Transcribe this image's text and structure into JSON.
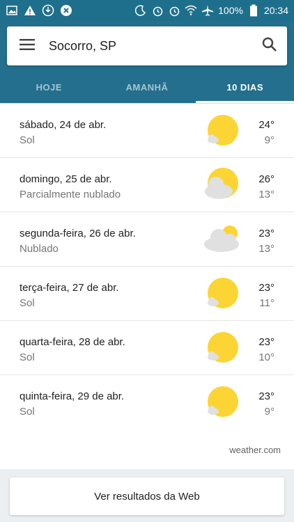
{
  "status_bar": {
    "battery": "100%",
    "time": "20:34",
    "left_icons": [
      "image-icon",
      "warning-icon",
      "download-icon",
      "blocked-icon"
    ],
    "right_icons": [
      "do-not-disturb-icon",
      "alarm-icon",
      "alarm-icon",
      "wifi-icon",
      "airplane-icon",
      "battery-icon"
    ]
  },
  "search": {
    "title": "Socorro, SP",
    "menu_icon": "menu-icon",
    "search_icon": "search-icon"
  },
  "tabs": [
    {
      "label": "HOJE",
      "active": false
    },
    {
      "label": "AMANHÃ",
      "active": false
    },
    {
      "label": "10 DIAS",
      "active": true
    }
  ],
  "days": [
    {
      "date": "sábado, 24 de abr.",
      "condition": "Sol",
      "high": "24°",
      "low": "9°",
      "icon": "sun-icon"
    },
    {
      "date": "domingo, 25 de abr.",
      "condition": "Parcialmente nublado",
      "high": "26°",
      "low": "13°",
      "icon": "partly-cloudy-icon"
    },
    {
      "date": "segunda-feira, 26 de abr.",
      "condition": "Nublado",
      "high": "23°",
      "low": "13°",
      "icon": "cloudy-icon"
    },
    {
      "date": "terça-feira, 27 de abr.",
      "condition": "Sol",
      "high": "23°",
      "low": "11°",
      "icon": "sun-icon"
    },
    {
      "date": "quarta-feira, 28 de abr.",
      "condition": "Sol",
      "high": "23°",
      "low": "10°",
      "icon": "sun-icon"
    },
    {
      "date": "quinta-feira, 29 de abr.",
      "condition": "Sol",
      "high": "23°",
      "low": "9°",
      "icon": "sun-icon"
    }
  ],
  "source": "weather.com",
  "web_button": "Ver resultados da Web",
  "colors": {
    "header": "#236f8d",
    "status_bar": "#1e6f8c",
    "sun": "#fcd535",
    "cloud": "#e0e0e0"
  }
}
